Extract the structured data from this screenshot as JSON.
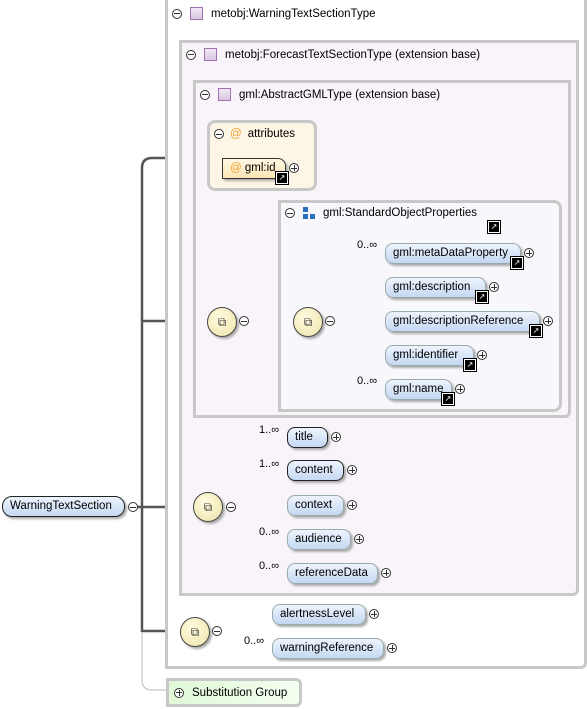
{
  "root_element": "WarningTextSection",
  "complex_type": "metobj:WarningTextSectionType",
  "forecast_base": "metobj:ForecastTextSectionType (extension base)",
  "gml_base": "gml:AbstractGMLType (extension base)",
  "attributes": {
    "label": "attributes",
    "items": [
      "gml:id"
    ]
  },
  "standard_group": {
    "label": "gml:StandardObjectProperties",
    "elements": [
      {
        "name": "gml:metaDataProperty",
        "card": "0..∞"
      },
      {
        "name": "gml:description",
        "card": ""
      },
      {
        "name": "gml:descriptionReference",
        "card": ""
      },
      {
        "name": "gml:identifier",
        "card": ""
      },
      {
        "name": "gml:name",
        "card": "0..∞"
      }
    ]
  },
  "forecast_elements": [
    {
      "name": "title",
      "card": "1..∞"
    },
    {
      "name": "content",
      "card": "1..∞"
    },
    {
      "name": "context",
      "card": ""
    },
    {
      "name": "audience",
      "card": "0..∞"
    },
    {
      "name": "referenceData",
      "card": "0..∞"
    }
  ],
  "warning_elements": [
    {
      "name": "alertnessLevel",
      "card": ""
    },
    {
      "name": "warningReference",
      "card": "0..∞"
    }
  ],
  "substitution_group": "Substitution Group",
  "colors": {
    "element_fill": "#c4d8f2",
    "attribute_fill": "#fdf5e6",
    "sequence_fill": "#ece3a8",
    "subst_fill": "#e6fae0"
  }
}
